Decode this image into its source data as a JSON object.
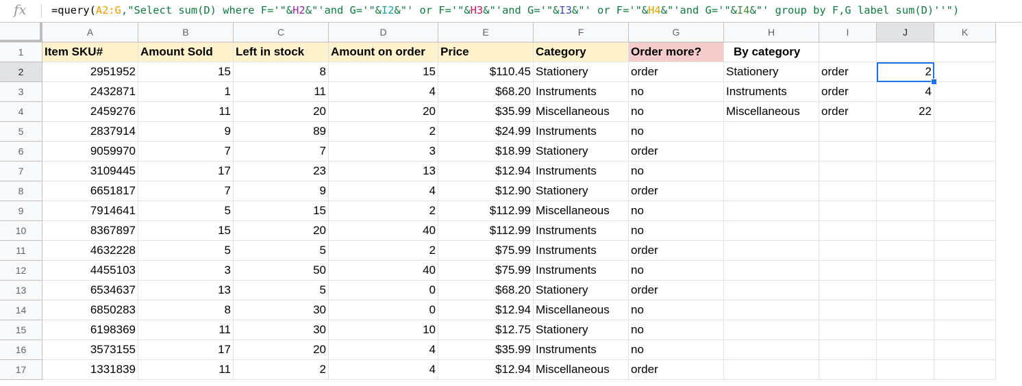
{
  "formula": {
    "fx_label": "fx",
    "parts": [
      {
        "t": "=query(",
        "c": ""
      },
      {
        "t": "A2:G",
        "c": "r"
      },
      {
        "t": ",\"Select sum(D) where F='\"&",
        "c": "s"
      },
      {
        "t": "H2",
        "c": "h2"
      },
      {
        "t": "&\"'and G='\"&",
        "c": "s"
      },
      {
        "t": "I2",
        "c": "i2"
      },
      {
        "t": "&\"' or F='\"&",
        "c": "s"
      },
      {
        "t": "H3",
        "c": "h3"
      },
      {
        "t": "&\"'and G='\"&",
        "c": "s"
      },
      {
        "t": "I3",
        "c": "i3"
      },
      {
        "t": "&\"' or F='\"&",
        "c": "s"
      },
      {
        "t": "H4",
        "c": "h4"
      },
      {
        "t": "&\"'and G='\"&",
        "c": "s"
      },
      {
        "t": "I4",
        "c": "i4"
      },
      {
        "t": "&\"' group by F,G label sum(D)''\")",
        "c": "s"
      }
    ]
  },
  "columns": [
    "A",
    "B",
    "C",
    "D",
    "E",
    "F",
    "G",
    "H",
    "I",
    "J",
    "K"
  ],
  "selected_column": "J",
  "header_row": [
    "Item SKU#",
    "Amount Sold",
    "Left  in stock",
    "Amount on order",
    "Price",
    "Category",
    "Order more?",
    "By category",
    "",
    "",
    ""
  ],
  "rows": [
    [
      "2951952",
      "15",
      "8",
      "15",
      "$110.45",
      "Stationery",
      "order",
      "Stationery",
      "order",
      "2",
      ""
    ],
    [
      "2432871",
      "1",
      "11",
      "4",
      "$68.20",
      "Instruments",
      "no",
      "Instruments",
      "order",
      "4",
      ""
    ],
    [
      "2459276",
      "11",
      "20",
      "20",
      "$35.99",
      "Miscellaneous",
      "no",
      "Miscellaneous",
      "order",
      "22",
      ""
    ],
    [
      "2837914",
      "9",
      "89",
      "2",
      "$24.99",
      "Instruments",
      "no",
      "",
      "",
      "",
      ""
    ],
    [
      "9059970",
      "7",
      "7",
      "3",
      "$18.99",
      "Stationery",
      "order",
      "",
      "",
      "",
      ""
    ],
    [
      "3109445",
      "17",
      "23",
      "13",
      "$12.94",
      "Instruments",
      "no",
      "",
      "",
      "",
      ""
    ],
    [
      "6651817",
      "7",
      "9",
      "4",
      "$12.90",
      "Stationery",
      "order",
      "",
      "",
      "",
      ""
    ],
    [
      "7914641",
      "5",
      "15",
      "2",
      "$112.99",
      "Miscellaneous",
      "no",
      "",
      "",
      "",
      ""
    ],
    [
      "8367897",
      "15",
      "20",
      "40",
      "$112.99",
      "Instruments",
      "no",
      "",
      "",
      "",
      ""
    ],
    [
      "4632228",
      "5",
      "5",
      "2",
      "$75.99",
      "Instruments",
      "order",
      "",
      "",
      "",
      ""
    ],
    [
      "4455103",
      "3",
      "50",
      "40",
      "$75.99",
      "Instruments",
      "no",
      "",
      "",
      "",
      ""
    ],
    [
      "6534637",
      "13",
      "5",
      "0",
      "$68.20",
      "Stationery",
      "order",
      "",
      "",
      "",
      ""
    ],
    [
      "6850283",
      "8",
      "30",
      "0",
      "$12.94",
      "Miscellaneous",
      "no",
      "",
      "",
      "",
      ""
    ],
    [
      "6198369",
      "11",
      "30",
      "10",
      "$12.75",
      "Stationery",
      "no",
      "",
      "",
      "",
      ""
    ],
    [
      "3573155",
      "17",
      "20",
      "4",
      "$35.99",
      "Instruments",
      "no",
      "",
      "",
      "",
      ""
    ],
    [
      "1331839",
      "11",
      "2",
      "4",
      "$12.94",
      "Miscellaneous",
      "order",
      "",
      "",
      "",
      ""
    ]
  ],
  "selected_cell": "J2",
  "colors": {
    "header_fill": "#fff2cc",
    "order_more_fill": "#f4cccc",
    "selection": "#1a73e8"
  }
}
